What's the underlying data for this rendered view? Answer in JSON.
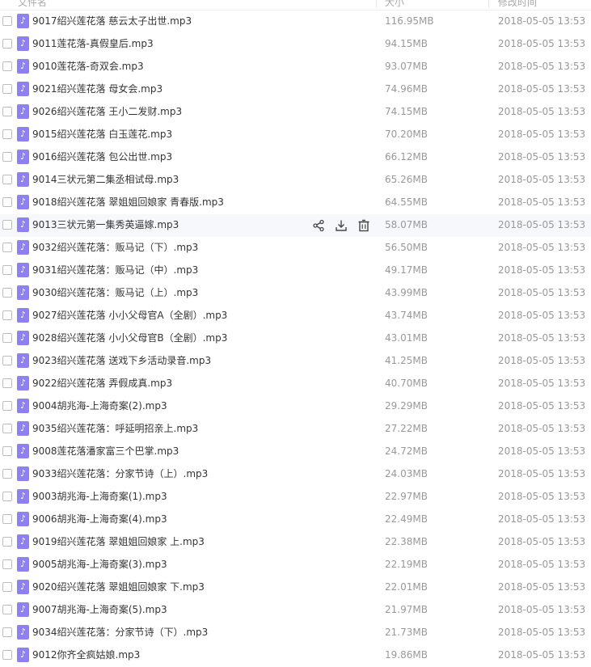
{
  "header": {
    "name": "文件名",
    "size": "大小",
    "time": "修改时间"
  },
  "files": [
    {
      "name": "9017绍兴莲花落 慈云太子出世.mp3",
      "size": "116.95MB",
      "time": "2018-05-05 13:53"
    },
    {
      "name": "9011莲花落-真假皇后.mp3",
      "size": "94.15MB",
      "time": "2018-05-05 13:53"
    },
    {
      "name": "9010莲花落-奇双会.mp3",
      "size": "93.07MB",
      "time": "2018-05-05 13:53"
    },
    {
      "name": "9021绍兴莲花落 母女会.mp3",
      "size": "74.96MB",
      "time": "2018-05-05 13:53"
    },
    {
      "name": "9026绍兴莲花落 王小二发财.mp3",
      "size": "74.15MB",
      "time": "2018-05-05 13:53"
    },
    {
      "name": "9015绍兴莲花落 白玉莲花.mp3",
      "size": "70.20MB",
      "time": "2018-05-05 13:53"
    },
    {
      "name": "9016绍兴莲花落 包公出世.mp3",
      "size": "66.12MB",
      "time": "2018-05-05 13:53"
    },
    {
      "name": "9014三状元第二集丞相试母.mp3",
      "size": "65.26MB",
      "time": "2018-05-05 13:53"
    },
    {
      "name": "9018绍兴莲花落 翠姐姐回娘家 青春版.mp3",
      "size": "64.55MB",
      "time": "2018-05-05 13:53"
    },
    {
      "name": "9013三状元第一集秀英逼嫁.mp3",
      "size": "58.07MB",
      "time": "2018-05-05 13:53",
      "hover": true
    },
    {
      "name": "9032绍兴莲花落：贩马记（下）.mp3",
      "size": "56.50MB",
      "time": "2018-05-05 13:53"
    },
    {
      "name": "9031绍兴莲花落：贩马记（中）.mp3",
      "size": "49.17MB",
      "time": "2018-05-05 13:53"
    },
    {
      "name": "9030绍兴莲花落：贩马记（上）.mp3",
      "size": "43.99MB",
      "time": "2018-05-05 13:53"
    },
    {
      "name": "9027绍兴莲花落 小小父母官A（全剧）.mp3",
      "size": "43.74MB",
      "time": "2018-05-05 13:53"
    },
    {
      "name": "9028绍兴莲花落 小小父母官B（全剧）.mp3",
      "size": "43.01MB",
      "time": "2018-05-05 13:53"
    },
    {
      "name": "9023绍兴莲花落 送戏下乡活动录音.mp3",
      "size": "41.25MB",
      "time": "2018-05-05 13:53"
    },
    {
      "name": "9022绍兴莲花落 弄假成真.mp3",
      "size": "40.70MB",
      "time": "2018-05-05 13:53"
    },
    {
      "name": "9004胡兆海-上海奇案(2).mp3",
      "size": "29.29MB",
      "time": "2018-05-05 13:53"
    },
    {
      "name": "9035绍兴莲花落：呼延明招亲上.mp3",
      "size": "27.22MB",
      "time": "2018-05-05 13:53"
    },
    {
      "name": "9008莲花落潘家富三个巴掌.mp3",
      "size": "24.72MB",
      "time": "2018-05-05 13:53"
    },
    {
      "name": "9033绍兴莲花落：分家节诗（上）.mp3",
      "size": "24.03MB",
      "time": "2018-05-05 13:53"
    },
    {
      "name": "9003胡兆海-上海奇案(1).mp3",
      "size": "22.97MB",
      "time": "2018-05-05 13:53"
    },
    {
      "name": "9006胡兆海-上海奇案(4).mp3",
      "size": "22.49MB",
      "time": "2018-05-05 13:53"
    },
    {
      "name": "9019绍兴莲花落 翠姐姐回娘家 上.mp3",
      "size": "22.38MB",
      "time": "2018-05-05 13:53"
    },
    {
      "name": "9005胡兆海-上海奇案(3).mp3",
      "size": "22.19MB",
      "time": "2018-05-05 13:53"
    },
    {
      "name": "9020绍兴莲花落 翠姐姐回娘家 下.mp3",
      "size": "22.01MB",
      "time": "2018-05-05 13:53"
    },
    {
      "name": "9007胡兆海-上海奇案(5).mp3",
      "size": "21.97MB",
      "time": "2018-05-05 13:53"
    },
    {
      "name": "9034绍兴莲花落：分家节诗（下）.mp3",
      "size": "21.73MB",
      "time": "2018-05-05 13:53"
    },
    {
      "name": "9012你齐全疯姑娘.mp3",
      "size": "19.86MB",
      "time": "2018-05-05 13:53"
    }
  ],
  "icons": {
    "file": "music-note-icon",
    "share": "share-icon",
    "download": "download-icon",
    "delete": "trash-icon"
  },
  "colors": {
    "file_icon": "#8d80f5",
    "hover_row": "#f6f8fc",
    "muted_text": "#999999"
  }
}
